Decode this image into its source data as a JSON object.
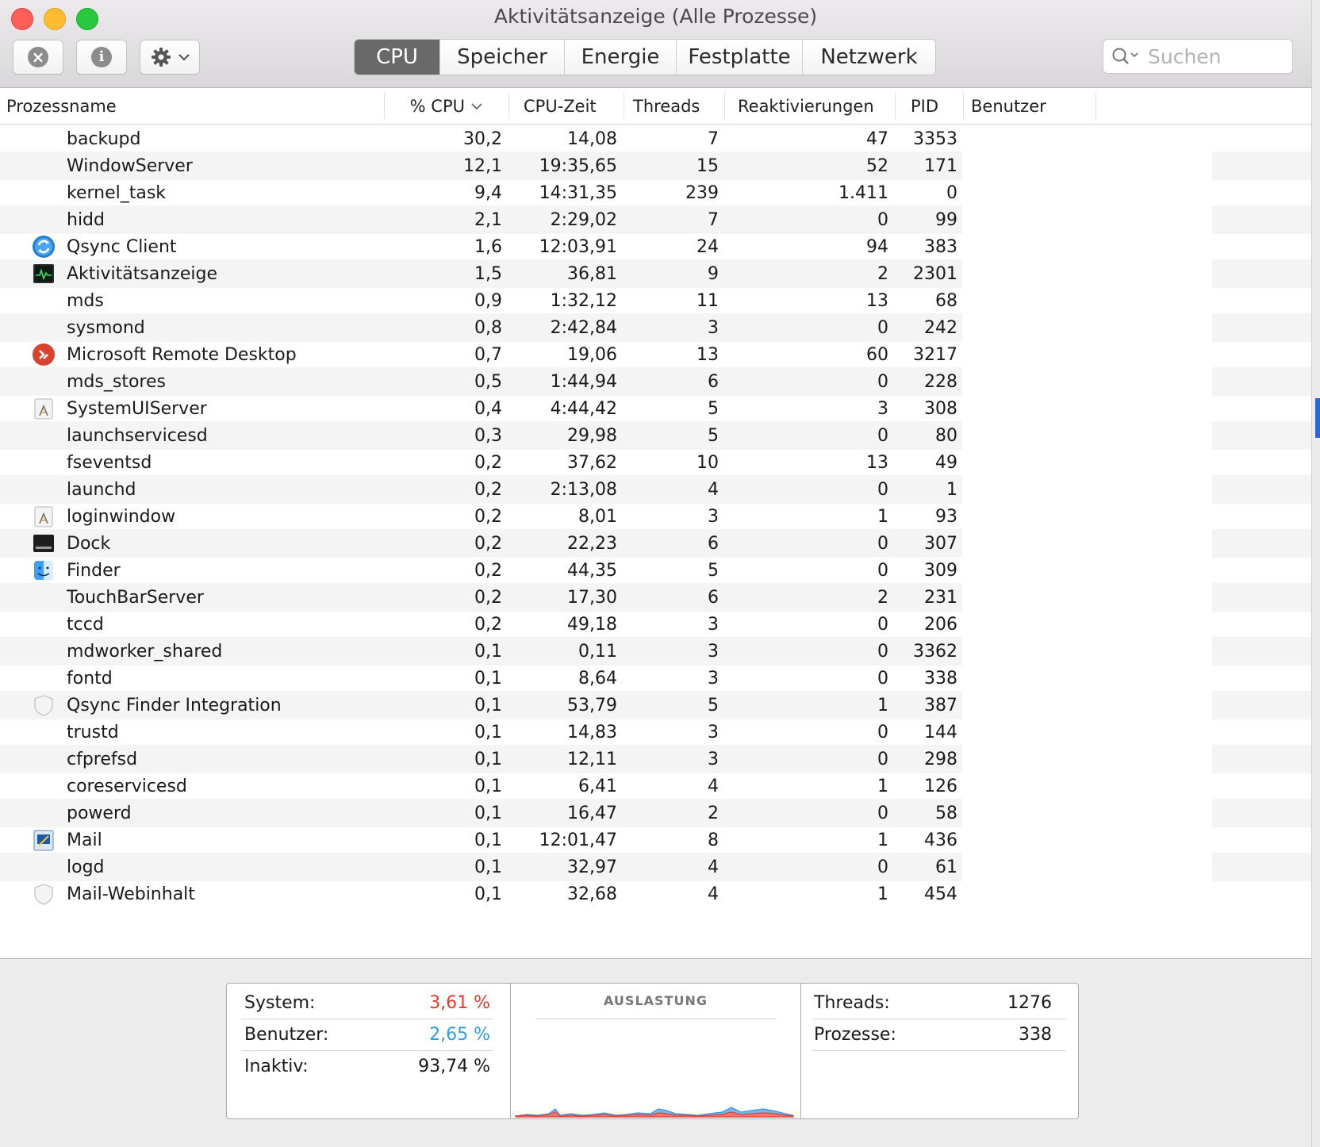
{
  "window": {
    "title": "Aktivitätsanzeige (Alle Prozesse)"
  },
  "toolbar": {
    "stop_icon": "x-circle-icon",
    "info_icon": "info-icon",
    "gear_icon": "gear-icon",
    "tabs": [
      "CPU",
      "Speicher",
      "Energie",
      "Festplatte",
      "Netzwerk"
    ],
    "active_tab": "CPU",
    "search_placeholder": "Suchen"
  },
  "table": {
    "columns": {
      "name": "Prozessname",
      "cpu": "% CPU",
      "cputime": "CPU-Zeit",
      "threads": "Threads",
      "wakeups": "Reaktivierungen",
      "pid": "PID",
      "user": "Benutzer"
    },
    "rows": [
      {
        "icon": "",
        "name": "backupd",
        "cpu": "30,2",
        "time": "14,08",
        "threads": "7",
        "wakeups": "47",
        "pid": "3353"
      },
      {
        "icon": "",
        "name": "WindowServer",
        "cpu": "12,1",
        "time": "19:35,65",
        "threads": "15",
        "wakeups": "52",
        "pid": "171"
      },
      {
        "icon": "",
        "name": "kernel_task",
        "cpu": "9,4",
        "time": "14:31,35",
        "threads": "239",
        "wakeups": "1.411",
        "pid": "0"
      },
      {
        "icon": "",
        "name": "hidd",
        "cpu": "2,1",
        "time": "2:29,02",
        "threads": "7",
        "wakeups": "0",
        "pid": "99"
      },
      {
        "icon": "qsync-icon",
        "name": "Qsync Client",
        "cpu": "1,6",
        "time": "12:03,91",
        "threads": "24",
        "wakeups": "94",
        "pid": "383"
      },
      {
        "icon": "activity-monitor-icon",
        "name": "Aktivitätsanzeige",
        "cpu": "1,5",
        "time": "36,81",
        "threads": "9",
        "wakeups": "2",
        "pid": "2301"
      },
      {
        "icon": "",
        "name": "mds",
        "cpu": "0,9",
        "time": "1:32,12",
        "threads": "11",
        "wakeups": "13",
        "pid": "68"
      },
      {
        "icon": "",
        "name": "sysmond",
        "cpu": "0,8",
        "time": "2:42,84",
        "threads": "3",
        "wakeups": "0",
        "pid": "242"
      },
      {
        "icon": "remote-desktop-icon",
        "name": "Microsoft Remote Desktop",
        "cpu": "0,7",
        "time": "19,06",
        "threads": "13",
        "wakeups": "60",
        "pid": "3217"
      },
      {
        "icon": "",
        "name": "mds_stores",
        "cpu": "0,5",
        "time": "1:44,94",
        "threads": "6",
        "wakeups": "0",
        "pid": "228"
      },
      {
        "icon": "generic-app-icon",
        "name": "SystemUIServer",
        "cpu": "0,4",
        "time": "4:44,42",
        "threads": "5",
        "wakeups": "3",
        "pid": "308"
      },
      {
        "icon": "",
        "name": "launchservicesd",
        "cpu": "0,3",
        "time": "29,98",
        "threads": "5",
        "wakeups": "0",
        "pid": "80"
      },
      {
        "icon": "",
        "name": "fseventsd",
        "cpu": "0,2",
        "time": "37,62",
        "threads": "10",
        "wakeups": "13",
        "pid": "49"
      },
      {
        "icon": "",
        "name": "launchd",
        "cpu": "0,2",
        "time": "2:13,08",
        "threads": "4",
        "wakeups": "0",
        "pid": "1"
      },
      {
        "icon": "generic-app-icon",
        "name": "loginwindow",
        "cpu": "0,2",
        "time": "8,01",
        "threads": "3",
        "wakeups": "1",
        "pid": "93"
      },
      {
        "icon": "dock-icon",
        "name": "Dock",
        "cpu": "0,2",
        "time": "22,23",
        "threads": "6",
        "wakeups": "0",
        "pid": "307"
      },
      {
        "icon": "finder-icon",
        "name": "Finder",
        "cpu": "0,2",
        "time": "44,35",
        "threads": "5",
        "wakeups": "0",
        "pid": "309"
      },
      {
        "icon": "",
        "name": "TouchBarServer",
        "cpu": "0,2",
        "time": "17,30",
        "threads": "6",
        "wakeups": "2",
        "pid": "231"
      },
      {
        "icon": "",
        "name": "tccd",
        "cpu": "0,2",
        "time": "49,18",
        "threads": "3",
        "wakeups": "0",
        "pid": "206"
      },
      {
        "icon": "",
        "name": "mdworker_shared",
        "cpu": "0,1",
        "time": "0,11",
        "threads": "3",
        "wakeups": "0",
        "pid": "3362"
      },
      {
        "icon": "",
        "name": "fontd",
        "cpu": "0,1",
        "time": "8,64",
        "threads": "3",
        "wakeups": "0",
        "pid": "338"
      },
      {
        "icon": "shield-icon",
        "name": "Qsync Finder Integration",
        "cpu": "0,1",
        "time": "53,79",
        "threads": "5",
        "wakeups": "1",
        "pid": "387"
      },
      {
        "icon": "",
        "name": "trustd",
        "cpu": "0,1",
        "time": "14,83",
        "threads": "3",
        "wakeups": "0",
        "pid": "144"
      },
      {
        "icon": "",
        "name": "cfprefsd",
        "cpu": "0,1",
        "time": "12,11",
        "threads": "3",
        "wakeups": "0",
        "pid": "298"
      },
      {
        "icon": "",
        "name": "coreservicesd",
        "cpu": "0,1",
        "time": "6,41",
        "threads": "4",
        "wakeups": "1",
        "pid": "126"
      },
      {
        "icon": "",
        "name": "powerd",
        "cpu": "0,1",
        "time": "16,47",
        "threads": "2",
        "wakeups": "0",
        "pid": "58"
      },
      {
        "icon": "mail-icon",
        "name": "Mail",
        "cpu": "0,1",
        "time": "12:01,47",
        "threads": "8",
        "wakeups": "1",
        "pid": "436"
      },
      {
        "icon": "",
        "name": "logd",
        "cpu": "0,1",
        "time": "32,97",
        "threads": "4",
        "wakeups": "0",
        "pid": "61"
      },
      {
        "icon": "shield-icon",
        "name": "Mail-Webinhalt",
        "cpu": "0,1",
        "time": "32,68",
        "threads": "4",
        "wakeups": "1",
        "pid": "454"
      }
    ]
  },
  "summary": {
    "system_label": "System:",
    "system_value": "3,61 %",
    "user_label": "Benutzer:",
    "user_value": "2,65 %",
    "idle_label": "Inaktiv:",
    "idle_value": "93,74 %",
    "load_title": "AUSLASTUNG",
    "threads_label": "Threads:",
    "threads_value": "1276",
    "processes_label": "Prozesse:",
    "processes_value": "338",
    "colors": {
      "system": "#e8392d",
      "user": "#2f9ce8"
    }
  }
}
